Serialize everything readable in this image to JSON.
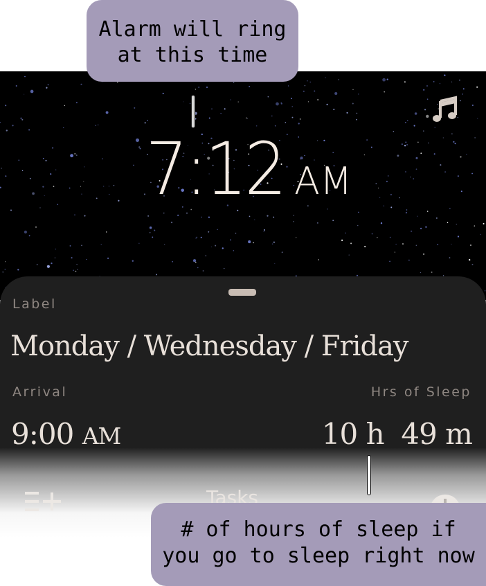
{
  "callouts": {
    "alarm_line1": "Alarm will ring",
    "alarm_line2": "at this time",
    "sleep_line1": "# of hours of sleep if",
    "sleep_line2": "you go to sleep right now"
  },
  "alarm": {
    "time": "7:12",
    "period": "AM",
    "music_icon": "music-note-icon"
  },
  "sheet": {
    "label_caption": "Label",
    "label_value": "Monday / Wednesday / Friday",
    "arrival_caption": "Arrival",
    "arrival_time": "9:00",
    "arrival_period": "AM",
    "sleep_caption": "Hrs of Sleep",
    "sleep_hours": "10",
    "sleep_hours_unit": "h",
    "sleep_minutes": "49",
    "sleep_minutes_unit": "m"
  },
  "tabbar": {
    "tasks_label": "Tasks",
    "add_icon": "list-add-icon",
    "right_icon": "clock-icon"
  },
  "colors": {
    "callout": "#a49bb8",
    "sheet": "#1f1f1f",
    "time_text": "#f5ece4",
    "caption_text": "#8f8782"
  }
}
